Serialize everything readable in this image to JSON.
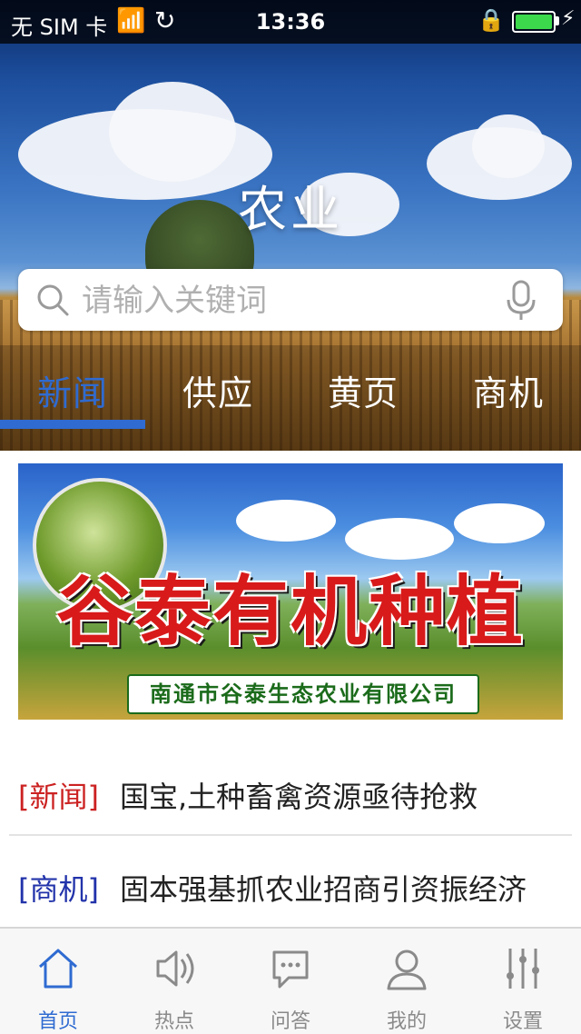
{
  "status_bar": {
    "carrier": "无 SIM 卡",
    "time": "13:36"
  },
  "header": {
    "title": "农业"
  },
  "search": {
    "placeholder": "请输入关键词"
  },
  "tabs": [
    {
      "label": "新闻",
      "active": true
    },
    {
      "label": "供应",
      "active": false
    },
    {
      "label": "黄页",
      "active": false
    },
    {
      "label": "商机",
      "active": false
    }
  ],
  "banner": {
    "title": "谷泰有机种植",
    "company": "南通市谷泰生态农业有限公司"
  },
  "news": [
    {
      "tag": "[新闻]",
      "title": "国宝,土种畜禽资源亟待抢救",
      "tag_color": "#cc2222"
    },
    {
      "tag": "[商机]",
      "title": "固本强基抓农业招商引资振经济",
      "tag_color": "#2233aa"
    }
  ],
  "bottom_nav": [
    {
      "label": "首页",
      "icon": "home-icon",
      "active": true
    },
    {
      "label": "热点",
      "icon": "speaker-icon",
      "active": false
    },
    {
      "label": "问答",
      "icon": "chat-icon",
      "active": false
    },
    {
      "label": "我的",
      "icon": "user-icon",
      "active": false
    },
    {
      "label": "设置",
      "icon": "sliders-icon",
      "active": false
    }
  ],
  "colors": {
    "accent": "#2f6bd1",
    "news_tag": "#cc2222",
    "business_tag": "#2233aa"
  }
}
